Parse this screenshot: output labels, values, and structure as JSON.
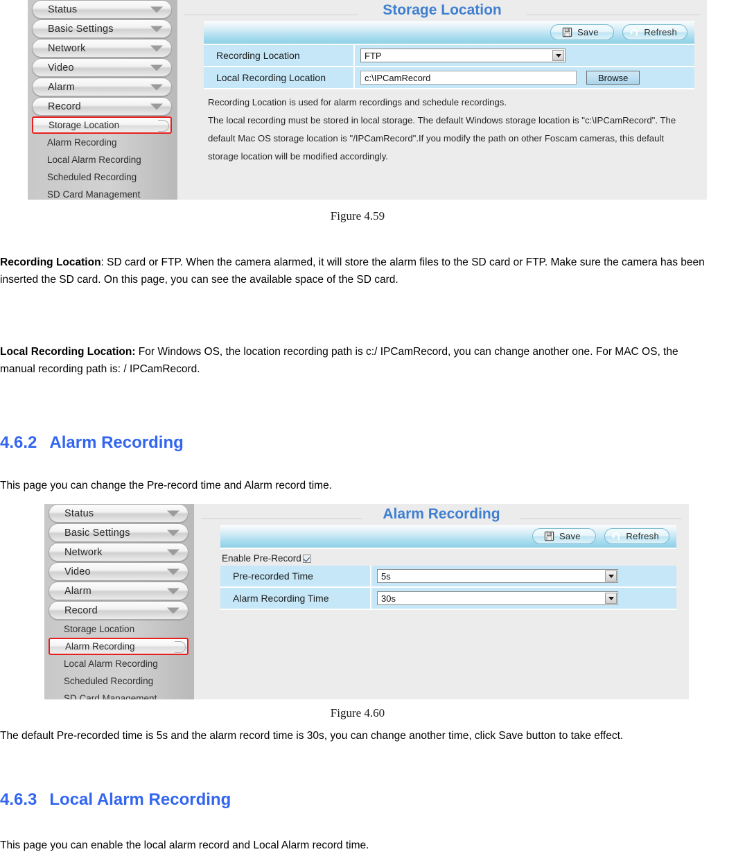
{
  "colors": {
    "heading_blue": "#3366f0",
    "panel_title_blue": "#3f7fd0",
    "selected_outline_red": "#e81f1f",
    "row_blue": "#c5e7f7",
    "toolbar_blue": "#8ed0e8",
    "sidebar_gray": "#cccccc"
  },
  "figure1": {
    "sidebar": {
      "top_items": [
        {
          "label": "Status"
        },
        {
          "label": "Basic Settings"
        },
        {
          "label": "Network"
        },
        {
          "label": "Video"
        },
        {
          "label": "Alarm"
        },
        {
          "label": "Record"
        }
      ],
      "sub_items": [
        {
          "label": "Storage Location",
          "selected": true
        },
        {
          "label": "Alarm Recording",
          "selected": false
        },
        {
          "label": "Local Alarm Recording",
          "selected": false
        },
        {
          "label": "Scheduled Recording",
          "selected": false
        },
        {
          "label": "SD Card Management",
          "selected": false
        }
      ]
    },
    "title": "Storage Location",
    "toolbar": {
      "save_label": "Save",
      "refresh_label": "Refresh"
    },
    "rows": [
      {
        "label": "Recording Location",
        "control": "select",
        "value": "FTP"
      },
      {
        "label": "Local Recording Location",
        "control": "text",
        "value": "c:\\IPCamRecord",
        "button_label": "Browse"
      }
    ],
    "notes": [
      "Recording Location is used for alarm recordings and schedule recordings.",
      "The local recording must be stored in local storage. The default Windows storage location is \"c:\\IPCamRecord\". The default Mac OS storage location is \"/IPCamRecord\".If you modify the path on other Foscam cameras, this default storage location will be modified accordingly."
    ]
  },
  "caption1": "Figure 4.59",
  "paragraphs": {
    "recording_location": {
      "bold": "Recording Location",
      "rest": ": SD card or FTP. When the camera alarmed, it will store the alarm files to the SD card or FTP. Make sure the camera has been inserted the SD card. On this page, you can see the available space of the SD card."
    },
    "local_recording_location": {
      "bold": "Local Recording Location:",
      "rest": " For Windows OS, the location recording path is c:/ IPCamRecord, you can change another one. For MAC OS, the manual recording path is: / IPCamRecord."
    },
    "intro_462": "This page you can change the Pre-record time and Alarm record time.",
    "after_fig460": "The default Pre-recorded time is 5s and the alarm record time is 30s, you can change another time, click Save button to take effect.",
    "intro_463": "This page you can enable the local alarm record and Local Alarm record time."
  },
  "section_462": {
    "number": "4.6.2",
    "title": "Alarm Recording"
  },
  "section_463": {
    "number": "4.6.3",
    "title": "Local Alarm Recording"
  },
  "figure2": {
    "sidebar": {
      "top_items": [
        {
          "label": "Status"
        },
        {
          "label": "Basic Settings"
        },
        {
          "label": "Network"
        },
        {
          "label": "Video"
        },
        {
          "label": "Alarm"
        },
        {
          "label": "Record"
        }
      ],
      "sub_items": [
        {
          "label": "Storage Location",
          "selected": false
        },
        {
          "label": "Alarm Recording",
          "selected": true
        },
        {
          "label": "Local Alarm Recording",
          "selected": false
        },
        {
          "label": "Scheduled Recording",
          "selected": false
        },
        {
          "label": "SD Card Management",
          "selected": false
        }
      ]
    },
    "title": "Alarm Recording",
    "toolbar": {
      "save_label": "Save",
      "refresh_label": "Refresh"
    },
    "checkbox": {
      "label": "Enable Pre-Record",
      "checked": true
    },
    "rows": [
      {
        "label": "Pre-recorded Time",
        "control": "select",
        "value": "5s"
      },
      {
        "label": "Alarm Recording Time",
        "control": "select",
        "value": "30s"
      }
    ]
  },
  "caption2": "Figure 4.60"
}
